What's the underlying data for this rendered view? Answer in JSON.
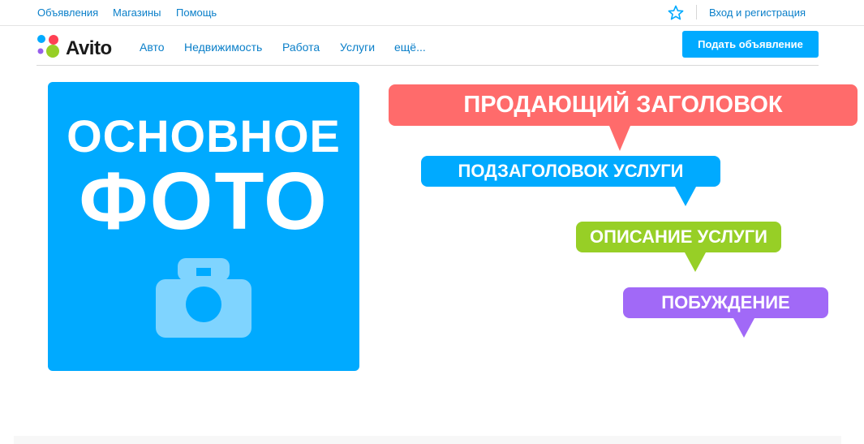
{
  "topbar": {
    "links": [
      "Объявления",
      "Магазины",
      "Помощь"
    ],
    "login_label": "Вход и регистрация",
    "favorites_icon": "star-outline-icon"
  },
  "header": {
    "logo_text": "Avito",
    "logo_dot_colors": [
      "#00aaff",
      "#ff4053",
      "#965eeb",
      "#97cf26"
    ],
    "nav": [
      "Авто",
      "Недвижимость",
      "Работа",
      "Услуги",
      "ещё..."
    ],
    "post_button_label": "Подать объявление"
  },
  "photo_card": {
    "line1": "ОСНОВНОЕ",
    "line2": "ФОТО",
    "icon": "camera-icon",
    "color": "#00aaff"
  },
  "bubbles": [
    {
      "text": "ПРОДАЮЩИЙ ЗАГОЛОВОК",
      "color": "#ff6b6b"
    },
    {
      "text": "ПОДЗАГОЛОВОК УСЛУГИ",
      "color": "#00aaff"
    },
    {
      "text": "ОПИСАНИЕ УСЛУГИ",
      "color": "#97cf26"
    },
    {
      "text": "ПОБУЖДЕНИЕ",
      "color": "#a169f7"
    }
  ]
}
